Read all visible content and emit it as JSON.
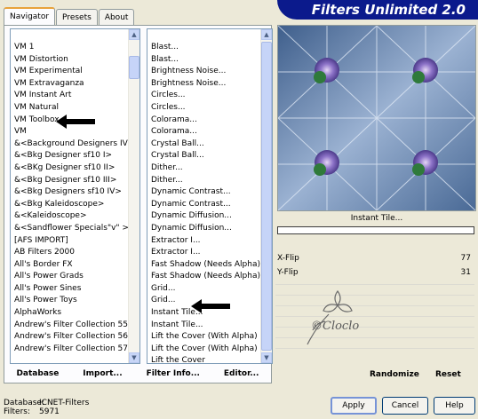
{
  "app": {
    "title": "Filters Unlimited 2.0"
  },
  "tabs": [
    {
      "label": "Navigator",
      "active": true
    },
    {
      "label": "Presets"
    },
    {
      "label": "About"
    }
  ],
  "categories": {
    "items": [
      "VM 1",
      "VM Distortion",
      "VM Experimental",
      "VM Extravaganza",
      "VM Instant Art",
      "VM Natural",
      "VM Toolbox",
      "VM",
      "&<Background Designers IV>",
      "&<Bkg Designer sf10 I>",
      "&<BKg Designer sf10 II>",
      "&<Bkg Designer sf10 III>",
      "&<Bkg Designers sf10 IV>",
      "&<Bkg Kaleidoscope>",
      "&<Kaleidoscope>",
      "&<Sandflower Specials\"v\" >",
      "[AFS IMPORT]",
      "AB Filters 2000",
      "All's Border FX",
      "All's Power Grads",
      "All's Power Sines",
      "All's Power Toys",
      "AlphaWorks",
      "Andrew's Filter Collection 55",
      "Andrew's Filter Collection 56",
      "Andrew's Filter Collection 57"
    ],
    "selected": "VM Toolbox"
  },
  "filters": {
    "items": [
      "Blast...",
      "Blast...",
      "Brightness Noise...",
      "Brightness Noise...",
      "Circles...",
      "Circles...",
      "Colorama...",
      "Colorama...",
      "Crystal Ball...",
      "Crystal Ball...",
      "Dither...",
      "Dither...",
      "Dynamic Contrast...",
      "Dynamic Contrast...",
      "Dynamic Diffusion...",
      "Dynamic Diffusion...",
      "Extractor I...",
      "Extractor I...",
      "Fast Shadow (Needs Alpha)",
      "Fast Shadow (Needs Alpha)",
      "Grid...",
      "Grid...",
      "Instant Tile...",
      "Instant Tile...",
      "Lift the Cover (With Alpha)",
      "Lift the Cover (With Alpha)",
      "Lift the Cover"
    ],
    "selected": "Instant Tile..."
  },
  "bottom_buttons": {
    "database": "Database",
    "import": "Import...",
    "filter_info": "Filter Info...",
    "editor": "Editor..."
  },
  "preview": {
    "caption": "Instant Tile..."
  },
  "progress": {
    "value": 0
  },
  "params": [
    {
      "label": "X-Flip",
      "value": "77"
    },
    {
      "label": "Y-Flip",
      "value": "31"
    }
  ],
  "watermark": {
    "text": "©Cloclo"
  },
  "right_buttons": {
    "randomize": "Randomize",
    "reset": "Reset"
  },
  "status": {
    "database_label": "Database:",
    "database_value": "ICNET-Filters",
    "filters_label": "Filters:",
    "filters_value": "5971"
  },
  "dialog_buttons": {
    "apply": "Apply",
    "cancel": "Cancel",
    "help": "Help"
  },
  "colors": {
    "title_bg": "#0b1a8c",
    "dialog_bg": "#ece9d8",
    "arrow": "#000000"
  }
}
